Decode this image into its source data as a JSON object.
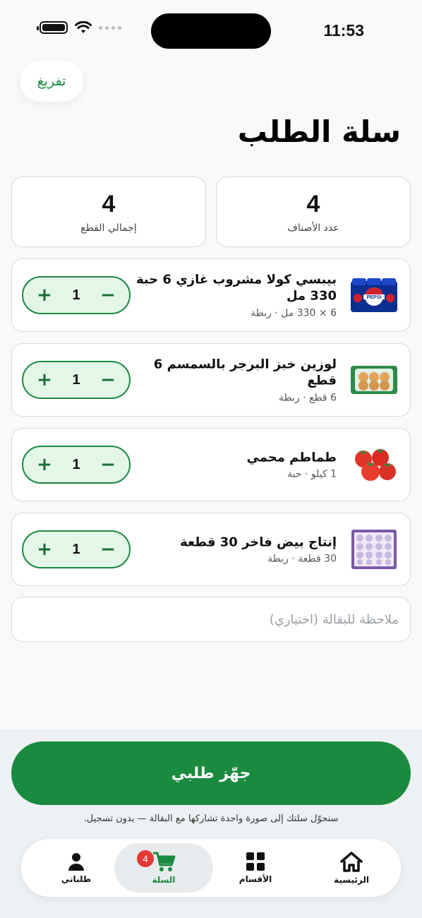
{
  "status": {
    "time": "11:53"
  },
  "header": {
    "clear_label": "تفريغ",
    "title": "سلة الطلب"
  },
  "stats": {
    "types_value": "4",
    "types_label": "عدد الأصناف",
    "pieces_value": "4",
    "pieces_label": "إجمالي القطع"
  },
  "items": [
    {
      "name": "بيبسي كولا مشروب غازي 6 حبة 330 مل",
      "sub": "6 × 330 مل · ربطة",
      "qty": "1",
      "image_icon": "pepsi-pack-icon"
    },
    {
      "name": "لوزين خبز البرجر بالسمسم 6 قطع",
      "sub": "6 قطع · ربطة",
      "qty": "1",
      "image_icon": "burger-buns-icon"
    },
    {
      "name": "طماطم محمي",
      "sub": "1 كيلو · حبة",
      "qty": "1",
      "image_icon": "tomatoes-icon"
    },
    {
      "name": "إنتاج بيض فاخر 30 قطعة",
      "sub": "30 قطعة · ربطة",
      "qty": "1",
      "image_icon": "egg-tray-icon"
    }
  ],
  "stepper": {
    "plus": "+",
    "minus": "−"
  },
  "note": {
    "placeholder": "ملاحظة للبقالة (اختياري)"
  },
  "checkout": {
    "label": "جهّز طلبي",
    "hint": "سنحوّل سلتك إلى صورة واحدة تشاركها مع البقالة — بدون تسجيل."
  },
  "tabs": [
    {
      "label": "الرئيسية",
      "icon": "home-icon"
    },
    {
      "label": "الأقسام",
      "icon": "grid-icon"
    },
    {
      "label": "السلة",
      "icon": "cart-icon",
      "badge": "4",
      "active": true
    },
    {
      "label": "طلباتي",
      "icon": "person-icon"
    }
  ],
  "colors": {
    "accent": "#1a8a3f",
    "badge": "#e53935"
  }
}
